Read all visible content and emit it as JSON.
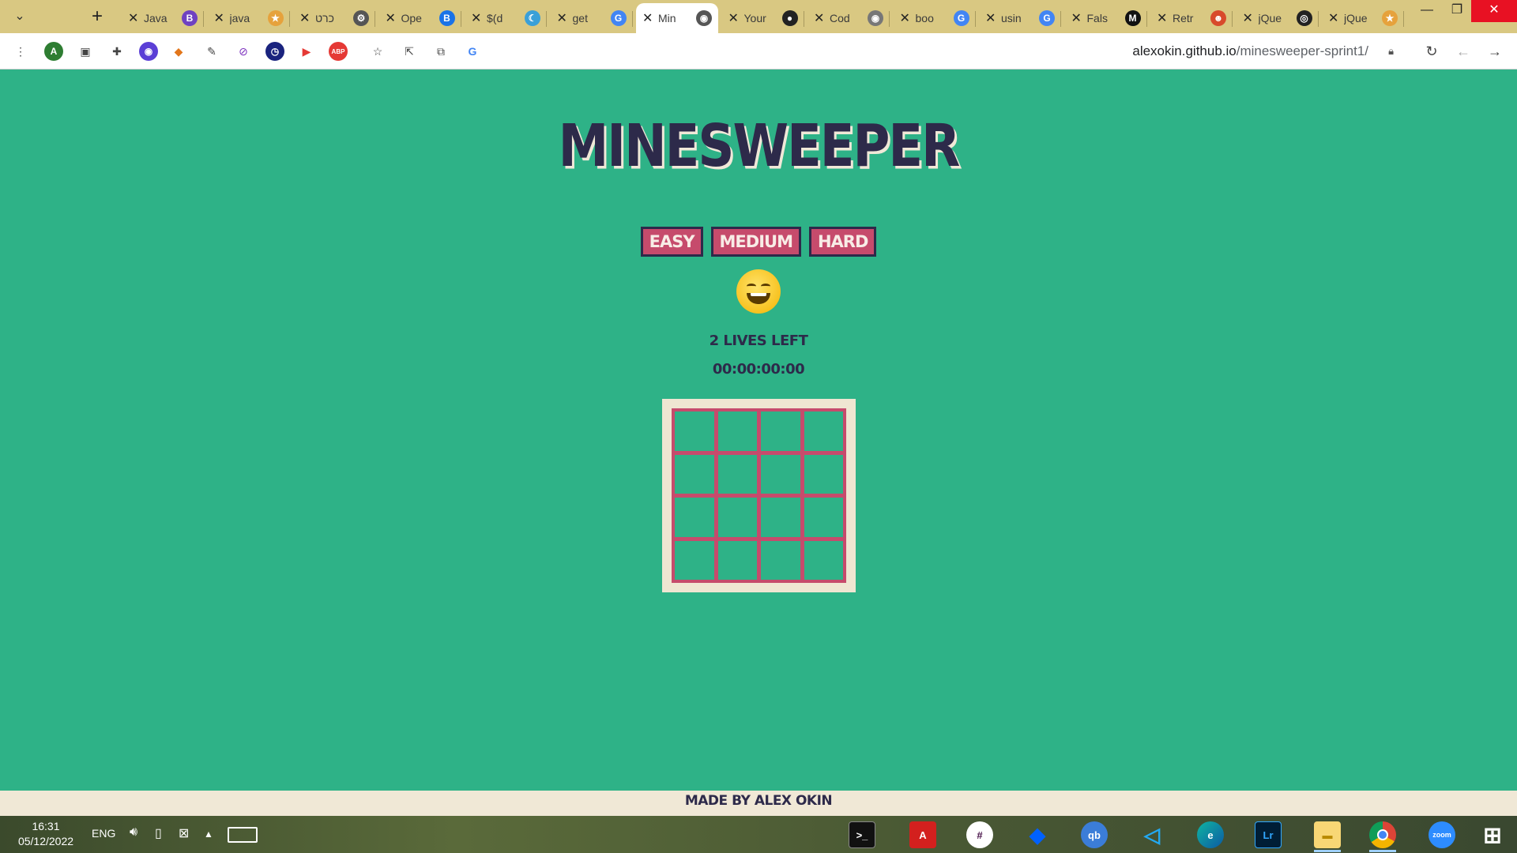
{
  "browser": {
    "tabs": [
      {
        "title": "Java",
        "favicon": "b-bootstrap-icon",
        "fav_color": "#6f42c1",
        "fav_text": "B"
      },
      {
        "title": "java",
        "favicon": "star-icon",
        "fav_color": "#e6a23c",
        "fav_text": "★"
      },
      {
        "title": "כרט",
        "favicon": "gear-icon",
        "fav_color": "#555555",
        "fav_text": "⚙"
      },
      {
        "title": "Ope",
        "favicon": "b-icon",
        "fav_color": "#1a73e8",
        "fav_text": "B"
      },
      {
        "title": "$(d",
        "favicon": "moon-icon",
        "fav_color": "#3aa0d8",
        "fav_text": "☾"
      },
      {
        "title": "get",
        "favicon": "google-icon",
        "fav_color": "#4285f4",
        "fav_text": "G"
      },
      {
        "title": "Min",
        "favicon": "globe-icon",
        "fav_color": "#555555",
        "fav_text": "◉",
        "active": true
      },
      {
        "title": "Your",
        "favicon": "github-icon",
        "fav_color": "#222222",
        "fav_text": "●"
      },
      {
        "title": "Cod",
        "favicon": "globe-icon",
        "fav_color": "#777777",
        "fav_text": "◉"
      },
      {
        "title": "boo",
        "favicon": "google-icon",
        "fav_color": "#4285f4",
        "fav_text": "G"
      },
      {
        "title": "usin",
        "favicon": "google-icon",
        "fav_color": "#4285f4",
        "fav_text": "G"
      },
      {
        "title": "Fals",
        "favicon": "m-icon",
        "fav_color": "#111111",
        "fav_text": "M"
      },
      {
        "title": "Retr",
        "favicon": "ninja-icon",
        "fav_color": "#d84a2b",
        "fav_text": "☻"
      },
      {
        "title": "jQue",
        "favicon": "circle-icon",
        "fav_color": "#222222",
        "fav_text": "◎"
      },
      {
        "title": "jQue",
        "favicon": "star-icon",
        "fav_color": "#e6a23c",
        "fav_text": "★"
      }
    ],
    "url_host": "alexokin.github.io",
    "url_path": "/minesweeper-sprint1/"
  },
  "game": {
    "title": "MINESWEEPER",
    "levels": [
      "EASY",
      "MEDIUM",
      "HARD"
    ],
    "lives_text": "2 LIVES LEFT",
    "timer": "00:00:00:00",
    "board_size": 4
  },
  "footer": {
    "credit": "MADE BY ALEX OKIN"
  },
  "taskbar": {
    "time": "16:31",
    "date": "05/12/2022",
    "language": "ENG",
    "apps": [
      "terminal",
      "acrobat",
      "slack",
      "dropbox",
      "qbittorrent",
      "vscode",
      "edge",
      "lightroom",
      "file-explorer",
      "chrome",
      "zoom"
    ]
  },
  "colors": {
    "page_bg": "#2eb287",
    "accent": "#c64b6c",
    "dark": "#2d2a4a",
    "cream": "#efe6d2"
  }
}
